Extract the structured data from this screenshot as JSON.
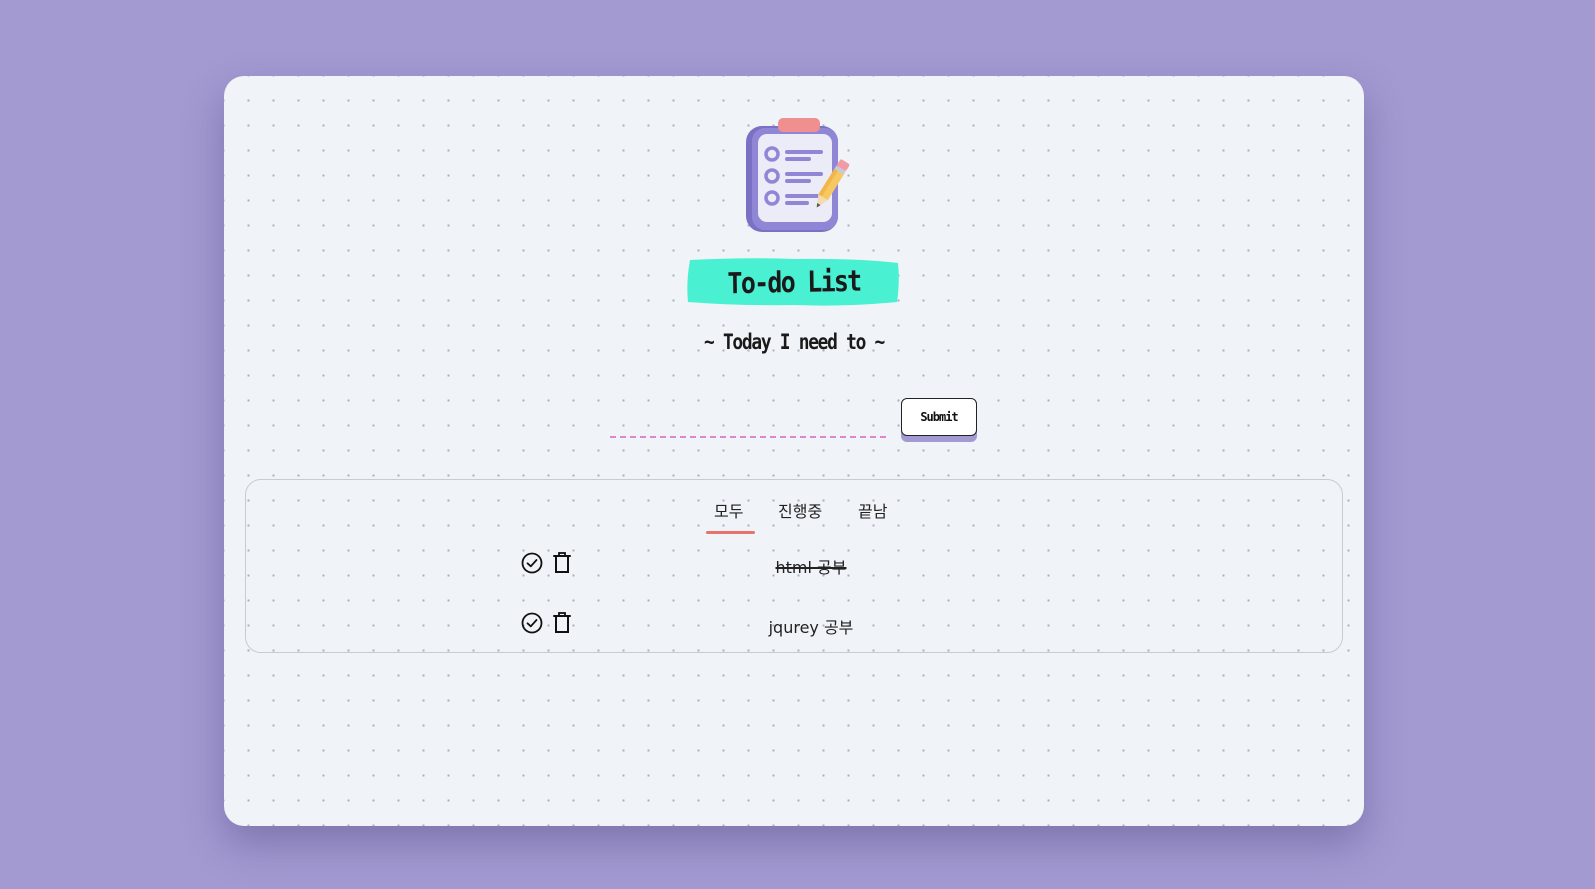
{
  "header": {
    "title": "To-do List",
    "subtitle": "~ Today I need to ~"
  },
  "form": {
    "input_value": "",
    "submit_label": "Submit"
  },
  "tabs": [
    {
      "label": "모두",
      "active": true
    },
    {
      "label": "진행중",
      "active": false
    },
    {
      "label": "끝남",
      "active": false
    }
  ],
  "tasks": [
    {
      "text": "html 공부",
      "done": true
    },
    {
      "text": "jqurey 공부",
      "done": false
    }
  ],
  "colors": {
    "background": "#a39ad2",
    "card": "#f0f3f7",
    "title_highlight": "#4af0d2",
    "tab_underline": "#e8736a",
    "input_underline": "#dd88cc",
    "clipboard": "#8079c9"
  },
  "icons": {
    "logo": "clipboard-checklist-pencil",
    "complete": "check-circle-icon",
    "delete": "trash-icon"
  }
}
